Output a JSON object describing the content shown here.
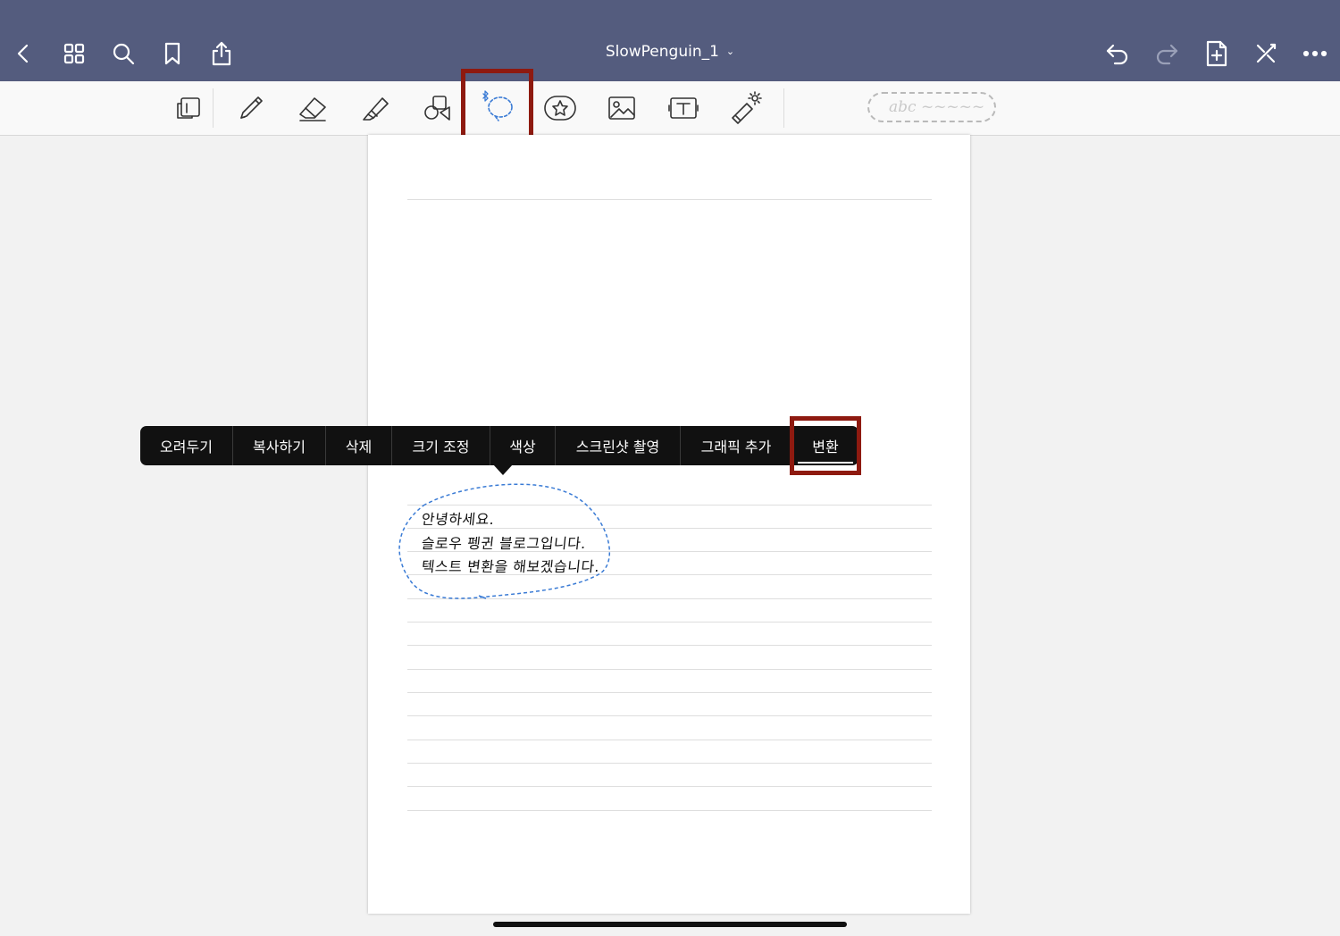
{
  "header": {
    "title": "SlowPenguin_1",
    "icons": [
      "back-icon",
      "grid-icon",
      "search-icon",
      "bookmark-icon",
      "share-icon",
      "undo-icon",
      "redo-icon",
      "add-page-icon",
      "close-pen-icon",
      "more-icon"
    ]
  },
  "toolbar": {
    "tools": [
      "page-view",
      "pen",
      "eraser",
      "highlighter",
      "shapes",
      "lasso",
      "sticker",
      "image",
      "text",
      "laser-pointer"
    ],
    "active_tool": "lasso",
    "handwriting_pill": "abc ~~~~~"
  },
  "context_menu": {
    "items": [
      "오려두기",
      "복사하기",
      "삭제",
      "크기 조정",
      "색상",
      "스크린샷 촬영",
      "그래픽 추가",
      "변환"
    ],
    "highlighted": "변환"
  },
  "note": {
    "lines": [
      "안녕하세요.",
      "슬로우 펭귄 블로그입니다.",
      "텍스트 변환을 해보겠습니다."
    ]
  },
  "colors": {
    "header_bg": "#545c7e",
    "highlight": "#8e1a10",
    "lasso_blue": "#3a7bd5"
  }
}
